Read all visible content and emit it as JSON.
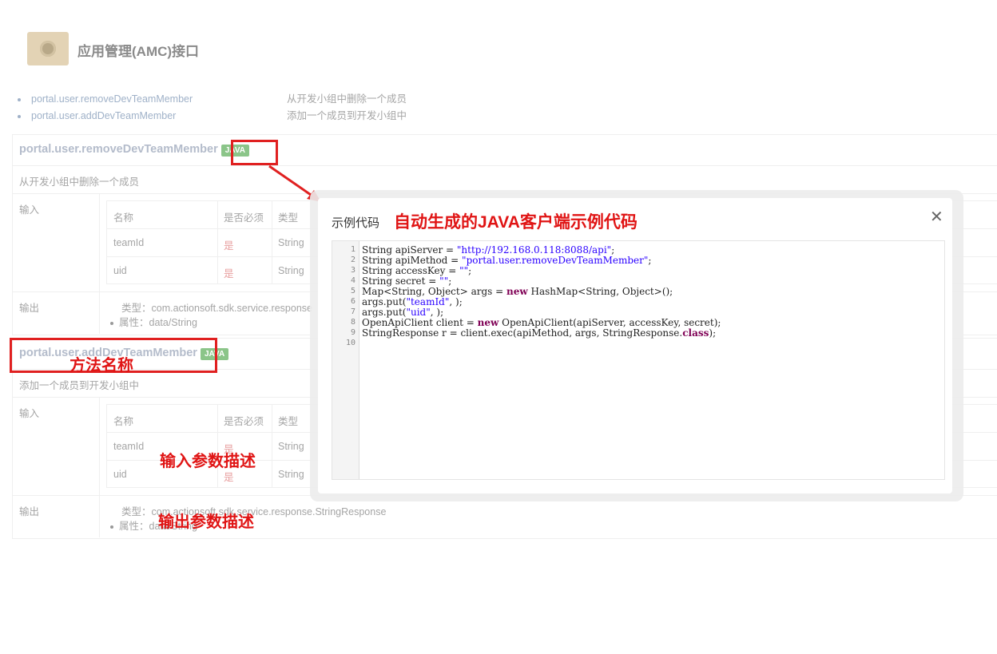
{
  "page": {
    "title": "应用管理(AMC)接口"
  },
  "toc": [
    {
      "name": "portal.user.removeDevTeamMember",
      "desc": "从开发小组中删除一个成员"
    },
    {
      "name": "portal.user.addDevTeamMember",
      "desc": "添加一个成员到开发小组中"
    }
  ],
  "methods": [
    {
      "name": "portal.user.removeDevTeamMember",
      "badge": "JAVA",
      "desc": "从开发小组中删除一个成员",
      "input_label": "输入",
      "output_label": "输出",
      "headers": [
        "名称",
        "是否必须",
        "类型"
      ],
      "params": [
        {
          "name": "teamId",
          "required": "是",
          "type": "String"
        },
        {
          "name": "uid",
          "required": "是",
          "type": "String"
        }
      ],
      "output_type": "类型：com.actionsoft.sdk.service.response",
      "output_attr": "属性：data/String"
    },
    {
      "name": "portal.user.addDevTeamMember",
      "badge": "JAVA",
      "desc": "添加一个成员到开发小组中",
      "input_label": "输入",
      "output_label": "输出",
      "headers": [
        "名称",
        "是否必须",
        "类型"
      ],
      "params": [
        {
          "name": "teamId",
          "required": "是",
          "type": "String"
        },
        {
          "name": "uid",
          "required": "是",
          "type": "String"
        }
      ],
      "output_type": "类型：com.actionsoft.sdk.service.response.StringResponse",
      "output_attr": "属性：data/String"
    }
  ],
  "annotations": {
    "method_name": "方法名称",
    "input_desc": "输入参数描述",
    "output_desc": "输出参数描述",
    "modal_note": "自动生成的JAVA客户端示例代码"
  },
  "modal": {
    "title": "示例代码",
    "close_icon": "close-icon",
    "line_numbers": [
      "1",
      "2",
      "3",
      "4",
      "5",
      "6",
      "7",
      "8",
      "9",
      "10"
    ]
  },
  "colors": {
    "annotation_red": "#e02020",
    "badge_green": "#8bc589"
  }
}
